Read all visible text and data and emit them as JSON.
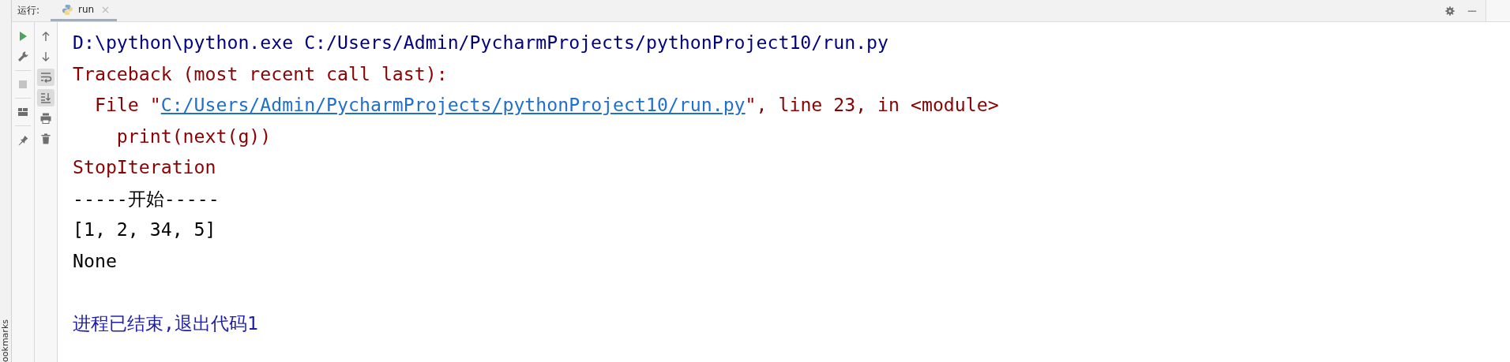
{
  "header": {
    "label": "运行:",
    "tabs": [
      {
        "title": "run",
        "selected": true
      }
    ]
  },
  "toolbar_left": [
    {
      "disabled": false
    },
    {
      "disabled": false
    },
    {
      "disabled": true
    },
    {
      "disabled": false
    },
    {
      "disabled": false
    }
  ],
  "toolbar_right": [
    {
      "on": false
    },
    {
      "on": false
    },
    {
      "on": true
    },
    {
      "on": true
    },
    {
      "on": false
    },
    {
      "on": false
    }
  ],
  "console": [
    {
      "kind": "command",
      "segments": [
        {
          "kind": "text",
          "text": "D:\\python\\python.exe C:/Users/Admin/PycharmProjects/pythonProject10/run.py"
        }
      ]
    },
    {
      "kind": "error",
      "segments": [
        {
          "kind": "text",
          "text": "Traceback (most recent call last):"
        }
      ]
    },
    {
      "kind": "error",
      "segments": [
        {
          "kind": "text",
          "text": "  File \""
        },
        {
          "kind": "link",
          "text": "C:/Users/Admin/PycharmProjects/pythonProject10/run.py"
        },
        {
          "kind": "text",
          "text": "\", line 23, in <module>"
        }
      ]
    },
    {
      "kind": "error",
      "segments": [
        {
          "kind": "text",
          "text": "    print(next(g))"
        }
      ]
    },
    {
      "kind": "error",
      "segments": [
        {
          "kind": "text",
          "text": "StopIteration"
        }
      ]
    },
    {
      "kind": "output",
      "segments": [
        {
          "kind": "text",
          "text": "-----开始-----"
        }
      ]
    },
    {
      "kind": "output",
      "segments": [
        {
          "kind": "text",
          "text": "[1, 2, 34, 5]"
        }
      ]
    },
    {
      "kind": "output",
      "segments": [
        {
          "kind": "text",
          "text": "None"
        }
      ]
    },
    {
      "kind": "blank"
    },
    {
      "kind": "exit",
      "segments": [
        {
          "kind": "text",
          "text": "进程已结束,退出代码1"
        }
      ]
    }
  ],
  "side_rail": {
    "label": "ookmarks"
  }
}
